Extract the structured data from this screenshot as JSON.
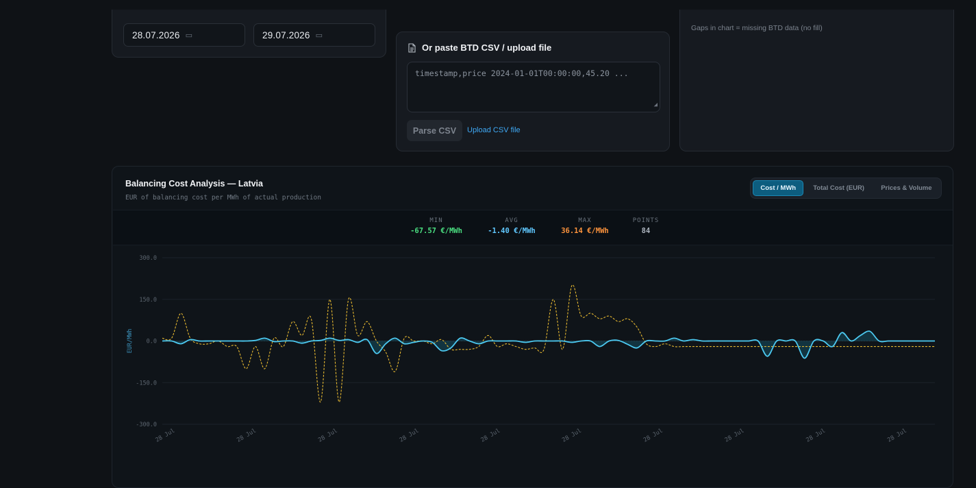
{
  "date_range": {
    "from": "28.07.2026",
    "to": "29.07.2026",
    "calendar_icon": "calendar-icon"
  },
  "csv_panel": {
    "title": "Or paste BTD CSV / upload file",
    "icon": "document-icon",
    "placeholder": "timestamp,price 2024-01-01T00:00:00,45.20 ...",
    "parse_label": "Parse CSV",
    "upload_label": "Upload CSV file"
  },
  "info_panel": {
    "note": "Gaps in chart = missing BTD data (no fill)"
  },
  "chart_panel": {
    "title": "Balancing Cost Analysis — Latvia",
    "subtitle": "EUR of balancing cost per MWh of actual production",
    "tabs": [
      {
        "label": "Cost / MWh",
        "active": true
      },
      {
        "label": "Total Cost (EUR)",
        "active": false
      },
      {
        "label": "Prices & Volume",
        "active": false
      }
    ],
    "stats": {
      "min": {
        "label": "MIN",
        "value": "-67.57 €/MWh",
        "color": "#4ade80"
      },
      "avg": {
        "label": "AVG",
        "value": "-1.40 €/MWh",
        "color": "#60c8ff"
      },
      "max": {
        "label": "MAX",
        "value": "36.14 €/MWh",
        "color": "#fb923c"
      },
      "points": {
        "label": "POINTS",
        "value": "84",
        "color": "#aab2bc"
      }
    }
  },
  "chart_data": {
    "type": "line",
    "title": "",
    "xlabel": "",
    "ylabel": "EUR/MWh",
    "ylim": [
      -300,
      300
    ],
    "y_ticks": [
      "300.0",
      "150.0",
      "0.0",
      "-150.0",
      "-300.0"
    ],
    "x_ticks": [
      "28 Jul",
      "28 Jul",
      "28 Jul",
      "28 Jul",
      "28 Jul",
      "28 Jul",
      "28 Jul",
      "28 Jul",
      "28 Jul",
      "28 Jul"
    ],
    "grid": true,
    "x": [
      0,
      1,
      2,
      3,
      4,
      5,
      6,
      7,
      8,
      9,
      10,
      11,
      12,
      13,
      14,
      15,
      16,
      17,
      18,
      19,
      20,
      21,
      22,
      23,
      24,
      25,
      26,
      27,
      28,
      29,
      30,
      31,
      32,
      33,
      34,
      35,
      36,
      37,
      38,
      39,
      40,
      41,
      42,
      43,
      44,
      45,
      46,
      47,
      48,
      49,
      50,
      51,
      52,
      53,
      54,
      55,
      56,
      57,
      58,
      59,
      60,
      61,
      62,
      63,
      64,
      65,
      66,
      67,
      68,
      69,
      70,
      71,
      72,
      73,
      74,
      75,
      76,
      77,
      78,
      79,
      80,
      81,
      82,
      83
    ],
    "series": [
      {
        "color": "#4cc9f0",
        "style": "solid",
        "values": [
          0,
          0,
          -10,
          5,
          0,
          0,
          0,
          0,
          0,
          0,
          2,
          10,
          -2,
          0,
          0,
          -8,
          0,
          2,
          10,
          2,
          5,
          -5,
          5,
          -45,
          -10,
          10,
          -10,
          -5,
          0,
          -5,
          -35,
          -25,
          10,
          0,
          -10,
          0,
          0,
          0,
          0,
          -5,
          0,
          0,
          0,
          0,
          -5,
          0,
          0,
          -20,
          0,
          2,
          -12,
          -25,
          0,
          0,
          0,
          10,
          0,
          5,
          0,
          0,
          0,
          0,
          0,
          0,
          0,
          -55,
          0,
          0,
          0,
          -62,
          0,
          0,
          -20,
          30,
          0,
          20,
          35,
          0,
          0,
          0,
          0,
          0,
          0,
          0
        ]
      },
      {
        "color": "#e6b830",
        "style": "dashed",
        "values": [
          10,
          10,
          100,
          10,
          -10,
          -10,
          0,
          -20,
          -20,
          -100,
          -20,
          -100,
          10,
          -20,
          70,
          20,
          80,
          -220,
          150,
          -220,
          150,
          20,
          70,
          0,
          -40,
          -110,
          10,
          0,
          0,
          -10,
          5,
          -30,
          -30,
          -30,
          -20,
          20,
          -20,
          -10,
          -20,
          -30,
          -25,
          -30,
          150,
          -30,
          200,
          90,
          100,
          80,
          90,
          70,
          80,
          50,
          -10,
          -20,
          -10,
          -20,
          -20,
          -20,
          -20,
          -20,
          -20,
          -20,
          -20,
          -20,
          -20,
          -20,
          -20,
          -20,
          -20,
          -20,
          -20,
          -20,
          -20,
          -20,
          -20,
          -20,
          -20,
          -20,
          -20,
          -20,
          -20,
          -20,
          -20,
          -20
        ]
      }
    ]
  }
}
